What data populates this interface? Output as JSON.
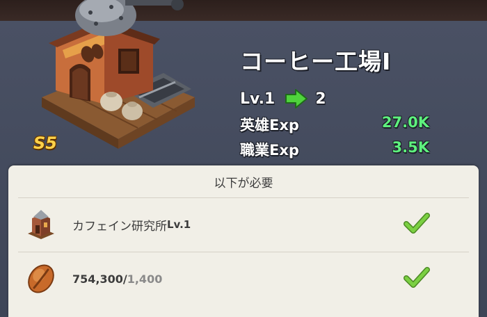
{
  "building": {
    "title": "コーヒー工場I",
    "tier_badge": "S5",
    "level_from": "Lv.1",
    "level_to": "2",
    "stats": [
      {
        "label": "英雄Exp",
        "value": "27.0K"
      },
      {
        "label": "職業Exp",
        "value": "3.5K"
      }
    ]
  },
  "requirements": {
    "header": "以下が必要",
    "items": [
      {
        "icon": "caffeine-lab-building-icon",
        "text": "カフェイン研究所",
        "suffix": "Lv.1",
        "met": true
      },
      {
        "icon": "coffee-bean-icon",
        "current": "754,300",
        "separator": "/",
        "required": "1,400",
        "met": true
      }
    ]
  },
  "colors": {
    "accent_green": "#5ef17e",
    "arrow_green": "#4fd33c",
    "tier_gold": "#ffd24a",
    "check_green": "#73c83c"
  }
}
